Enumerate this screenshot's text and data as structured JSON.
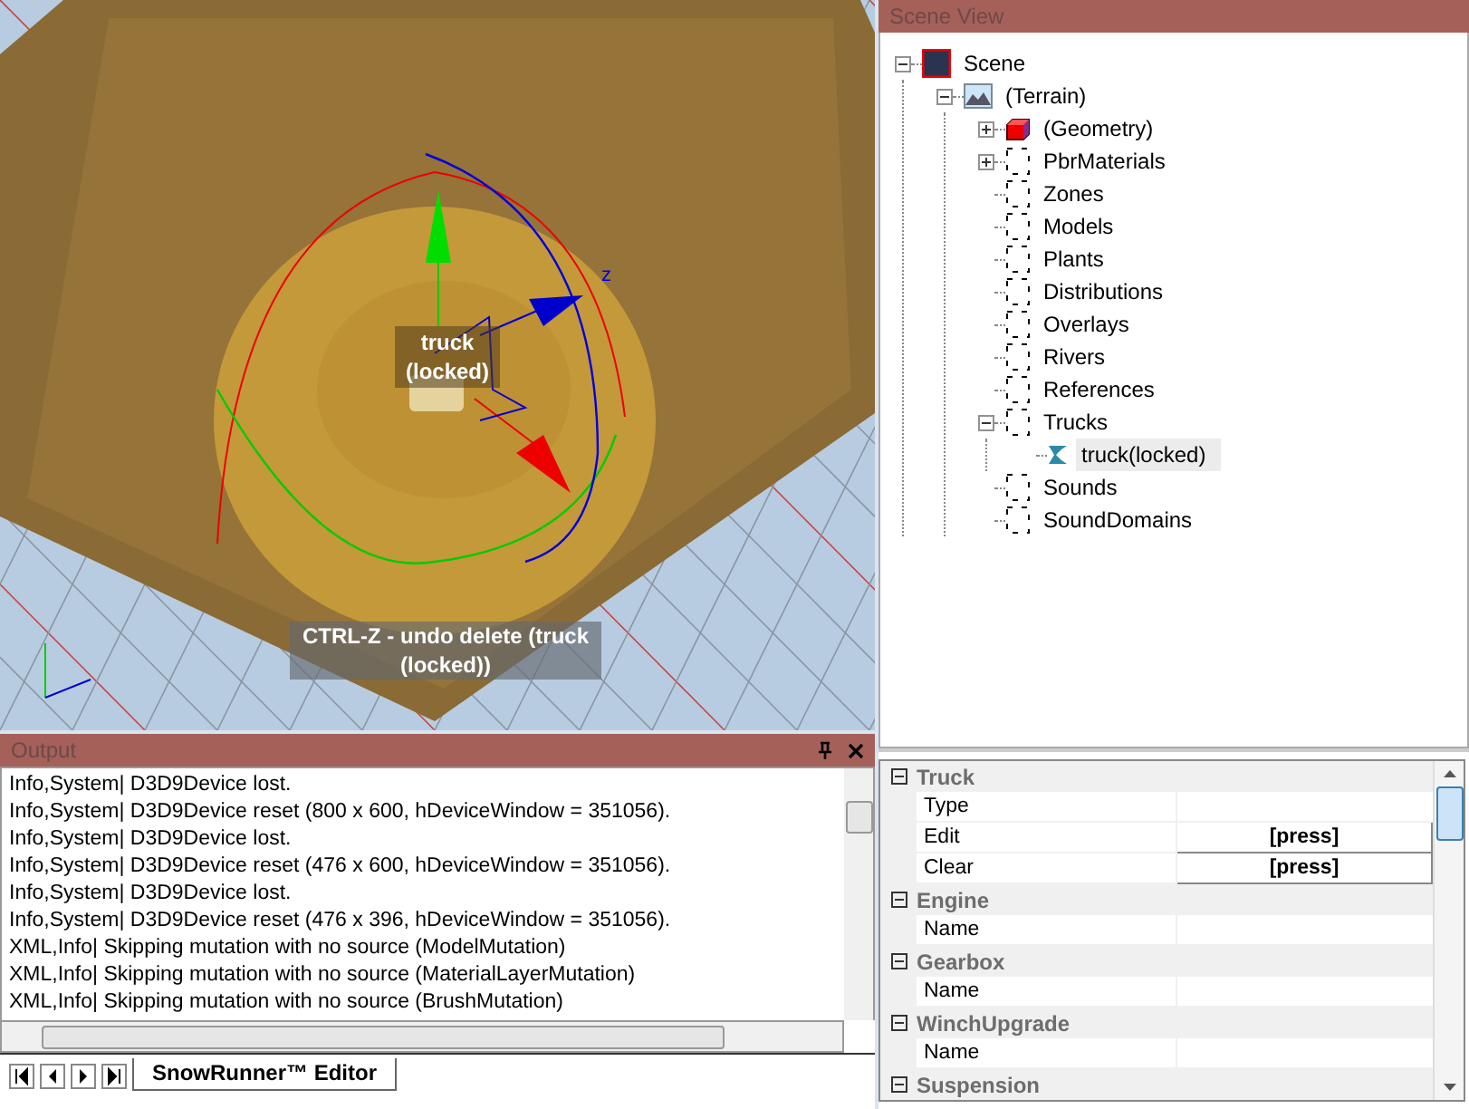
{
  "viewport": {
    "object_label": "truck (locked)",
    "axis_label": "z",
    "hint": "CTRL-Z - undo delete (truck (locked))"
  },
  "output": {
    "title": "Output",
    "lines": [
      "Info,System| D3D9Device lost.",
      "Info,System| D3D9Device reset (800 x 600, hDeviceWindow = 351056).",
      "Info,System| D3D9Device lost.",
      "Info,System| D3D9Device reset (476 x 600, hDeviceWindow = 351056).",
      "Info,System| D3D9Device lost.",
      "Info,System| D3D9Device reset (476 x 396, hDeviceWindow = 351056).",
      "XML,Info| Skipping mutation with no source (ModelMutation)",
      "XML,Info| Skipping mutation with no source (MaterialLayerMutation)",
      "XML,Info| Skipping mutation with no source (BrushMutation)"
    ],
    "tabs": [
      {
        "label": "SnowRunner™ Editor",
        "selected": true
      }
    ]
  },
  "scene_view": {
    "title": "Scene View",
    "tree": [
      {
        "label": "Scene",
        "kind": "scene",
        "expanded": true,
        "selected": false,
        "children": [
          {
            "label": "(Terrain)",
            "kind": "terrain",
            "expanded": true,
            "selected": false,
            "children": [
              {
                "label": "(Geometry)",
                "kind": "geometry",
                "expanded": false,
                "selected": false
              },
              {
                "label": "PbrMaterials",
                "kind": "folder",
                "expanded": false,
                "selected": false
              },
              {
                "label": "Zones",
                "kind": "folder",
                "selected": false
              },
              {
                "label": "Models",
                "kind": "folder",
                "selected": false
              },
              {
                "label": "Plants",
                "kind": "folder",
                "selected": false
              },
              {
                "label": "Distributions",
                "kind": "folder",
                "selected": false
              },
              {
                "label": "Overlays",
                "kind": "folder",
                "selected": false
              },
              {
                "label": "Rivers",
                "kind": "folder",
                "selected": false
              },
              {
                "label": "References",
                "kind": "folder",
                "selected": false
              },
              {
                "label": "Trucks",
                "kind": "folder",
                "expanded": true,
                "selected": false,
                "children": [
                  {
                    "label": "truck(locked)",
                    "kind": "object",
                    "selected": true
                  }
                ]
              },
              {
                "label": "Sounds",
                "kind": "folder",
                "selected": false
              },
              {
                "label": "SoundDomains",
                "kind": "folder",
                "selected": false
              }
            ]
          }
        ]
      }
    ]
  },
  "properties": [
    {
      "category": "Truck",
      "expanded": true,
      "rows": [
        {
          "name": "Type"
        },
        {
          "name": "Edit",
          "value": "[press]"
        },
        {
          "name": "Clear",
          "value": "[press]"
        }
      ]
    },
    {
      "category": "Engine",
      "expanded": true,
      "rows": [
        {
          "name": "Name"
        }
      ]
    },
    {
      "category": "Gearbox",
      "expanded": true,
      "rows": [
        {
          "name": "Name"
        }
      ]
    },
    {
      "category": "WinchUpgrade",
      "expanded": true,
      "rows": [
        {
          "name": "Name"
        }
      ]
    },
    {
      "category": "Suspension",
      "expanded": true
    }
  ]
}
